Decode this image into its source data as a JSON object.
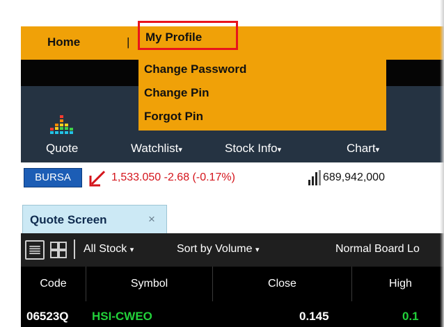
{
  "menu": {
    "home_label": "Home",
    "separator": "|",
    "profile_label": "My Profile",
    "dropdown": [
      "Change Password",
      "Change Pin",
      "Forgot Pin"
    ]
  },
  "toolbar": {
    "quote_label": "Quote",
    "watchlist_label": "Watchlist",
    "stockinfo_label": "Stock Info",
    "chart_label": "Chart",
    "caret": "▾"
  },
  "index": {
    "market_label": "BURSA",
    "value_text": "1,533.050 -2.68 (-0.17%)",
    "volume": "689,942,000"
  },
  "tab": {
    "label": "Quote Screen",
    "close": "×"
  },
  "filters": {
    "all_stock": "All Stock",
    "sort_by": "Sort by Volume",
    "board": "Normal Board Lo",
    "caret": "▾",
    "separator": "|"
  },
  "table": {
    "columns": [
      "Code",
      "Symbol",
      "Close",
      "High"
    ],
    "partial_row": [
      "06523Q",
      "HSI-CWEO",
      "0.145",
      "0.1"
    ]
  },
  "colors": {
    "menu_orange": "#f0a108",
    "highlight_red": "#e8141c",
    "toolbar_navy": "#253342",
    "down_red": "#d4141b",
    "bursa_blue": "#1c5db5",
    "tab_blue": "#cce9f5"
  }
}
